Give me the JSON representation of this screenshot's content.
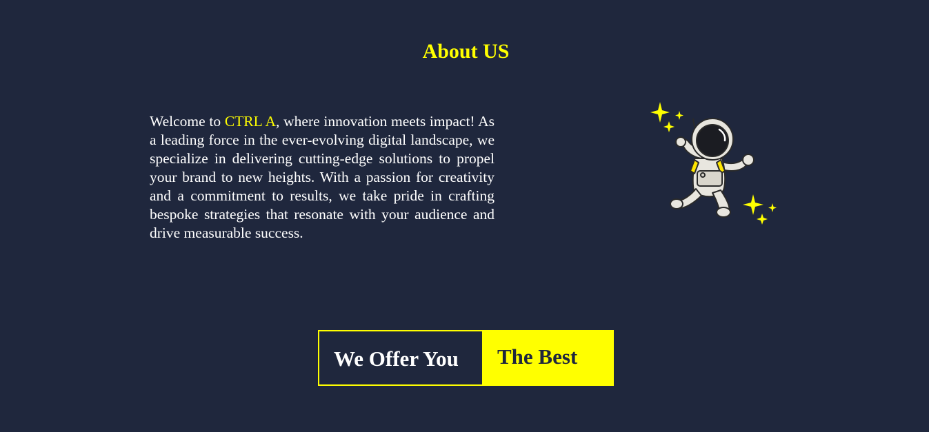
{
  "about": {
    "title": "About US",
    "intro_prefix": "Welcome to ",
    "brand_name": "CTRL A",
    "intro_rest": ", where innovation meets impact! As a leading force in the ever-evolving digital landscape, we specialize in delivering cutting-edge solutions to propel your brand to new heights. With a passion for creativity and a commitment to results, we take pride in crafting bespoke strategies that resonate with your audience and drive measurable success."
  },
  "offer": {
    "left_label": "We Offer You",
    "right_label": "The Best"
  },
  "illustration": {
    "icon": "astronaut-icon",
    "sparkle_icon": "sparkle-icon"
  },
  "colors": {
    "background": "#1f273d",
    "accent": "#ffff00",
    "text": "#ffffff"
  }
}
